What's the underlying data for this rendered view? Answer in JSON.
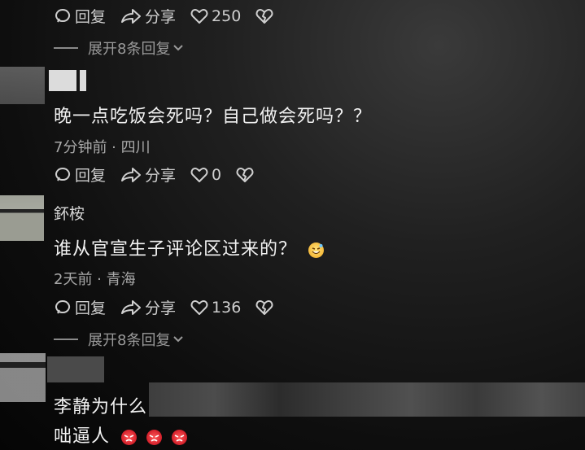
{
  "top": {
    "reply_label": "回复",
    "share_label": "分享",
    "like_count": "250",
    "expand_label": "展开8条回复"
  },
  "comments": [
    {
      "text": "晚一点吃饭会死吗？自己做会死吗？？",
      "time": "7分钟前",
      "location": "四川",
      "reply_label": "回复",
      "share_label": "分享",
      "like_count": "0"
    },
    {
      "username": "鈈桉",
      "text": "谁从官宣生子评论区过来的？",
      "emoji": "sweat-smile-emoji",
      "time": "2天前",
      "location": "青海",
      "reply_label": "回复",
      "share_label": "分享",
      "like_count": "136",
      "expand_label": "展开8条回复"
    },
    {
      "text_line1": "李静为什么",
      "text_line2": "咄逼人",
      "emojis": [
        "angry-emoji",
        "angry-emoji",
        "angry-emoji"
      ]
    }
  ],
  "meta_separator": " · "
}
